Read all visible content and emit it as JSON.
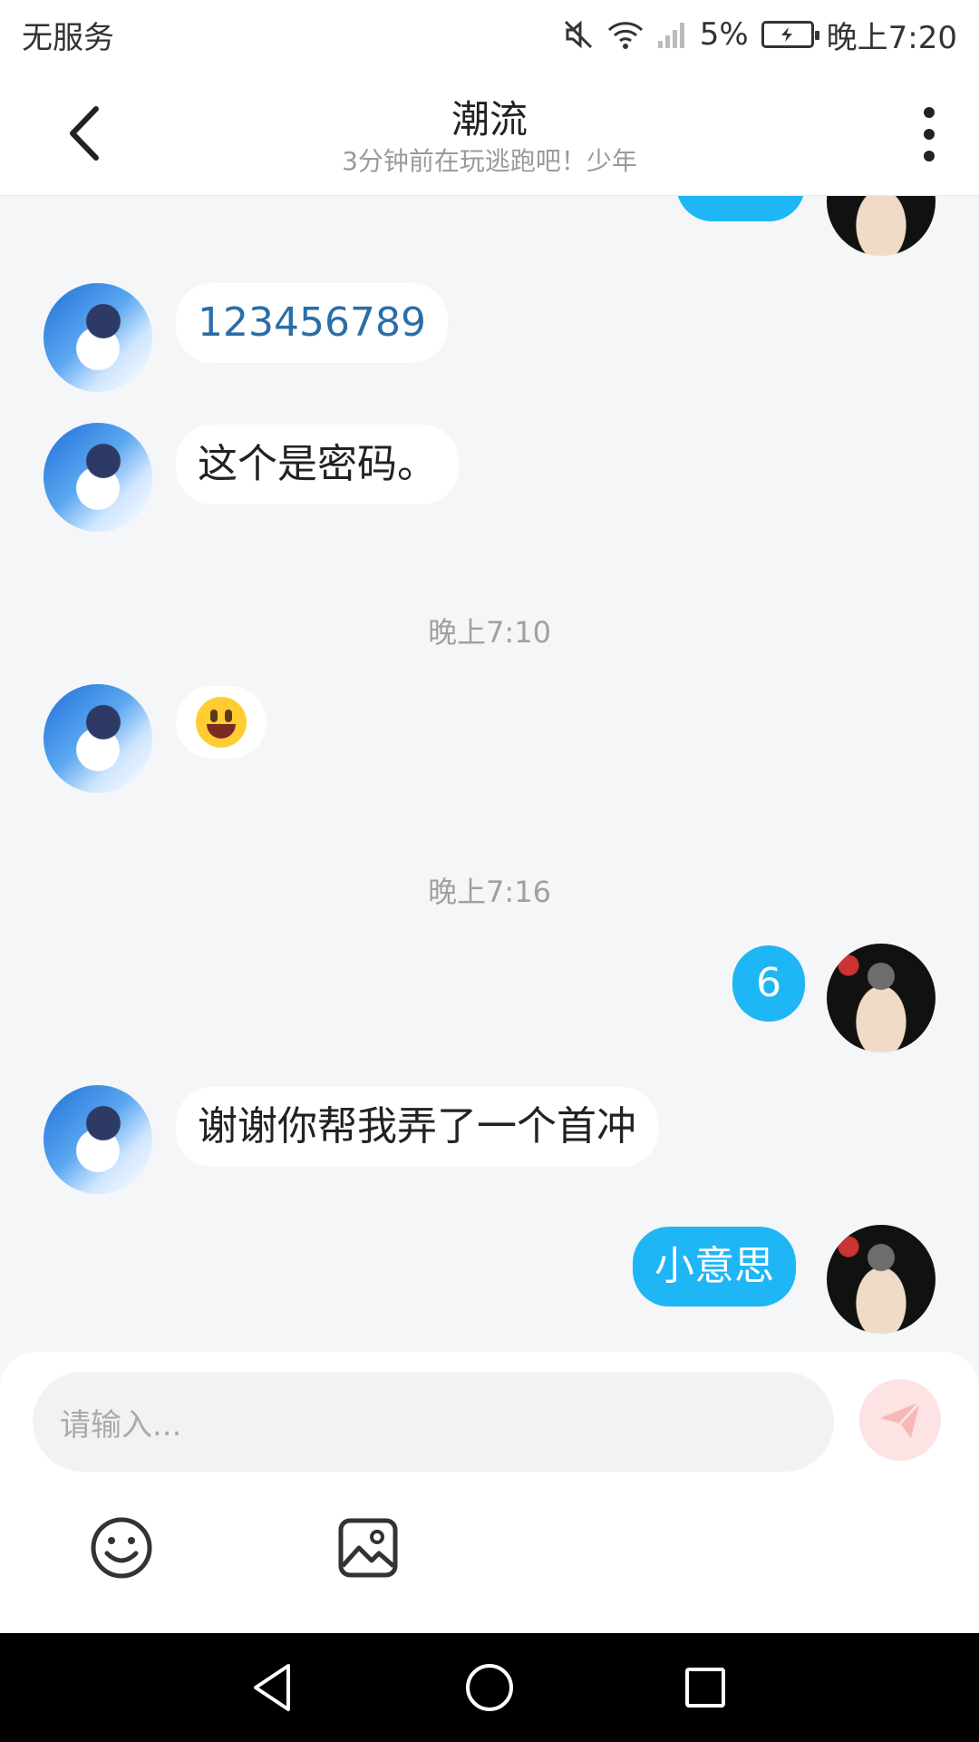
{
  "status_bar": {
    "carrier": "无服务",
    "battery": "5%",
    "time": "晚上7:20",
    "icons": [
      "mute-icon",
      "wifi-icon",
      "signal-icon",
      "battery-icon"
    ]
  },
  "header": {
    "title": "潮流",
    "subtitle": "3分钟前在玩逃跑吧！少年"
  },
  "chat": {
    "partial_top_message": "",
    "messages": [
      {
        "side": "in",
        "text": "123456789"
      },
      {
        "side": "in",
        "text": "这个是密码。"
      },
      {
        "type": "time",
        "text": "晚上7:10"
      },
      {
        "side": "in",
        "emoji": "smiley-emoji"
      },
      {
        "type": "time",
        "text": "晚上7:16"
      },
      {
        "side": "out",
        "text": "6"
      },
      {
        "side": "in",
        "text": "谢谢你帮我弄了一个首冲"
      },
      {
        "side": "out",
        "text": "小意思"
      }
    ]
  },
  "input": {
    "placeholder": "请输入..."
  },
  "colors": {
    "outgoing_bubble": "#1eb6f4",
    "incoming_bubble": "#ffffff",
    "chat_background": "#f4f6f8",
    "send_button": "#fde3e3"
  }
}
